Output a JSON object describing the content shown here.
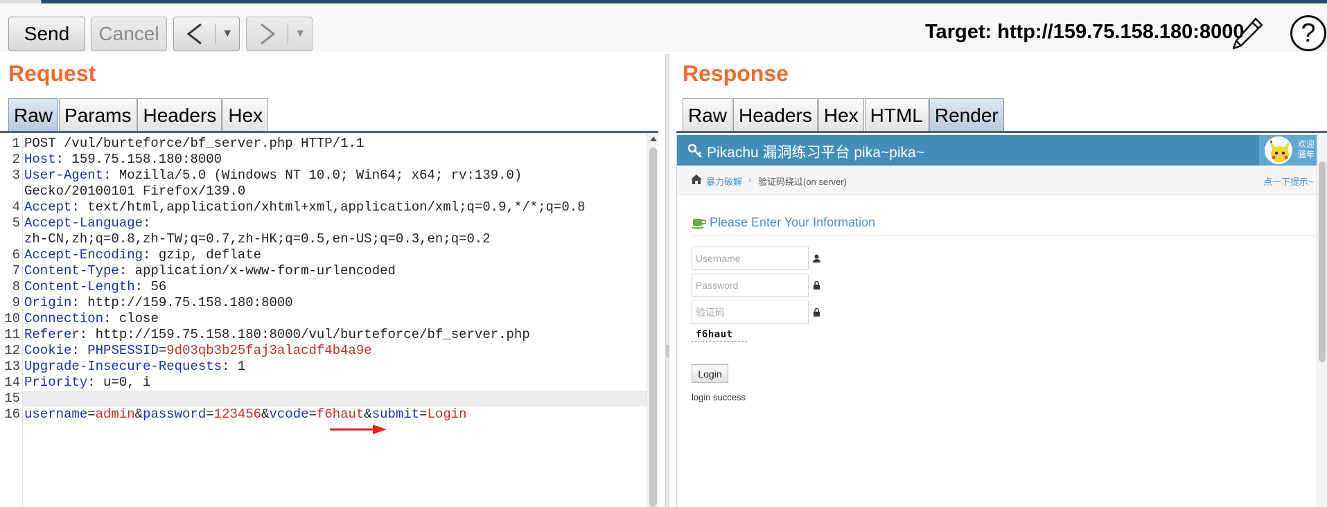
{
  "toolbar": {
    "send_label": "Send",
    "cancel_label": "Cancel",
    "back_glyph": "<",
    "forward_glyph": ">",
    "dropdown_glyph": "▼",
    "target_text": "Target: http://159.75.158.180:8000",
    "edit_icon": "pencil-icon",
    "help_glyph": "?"
  },
  "request": {
    "title": "Request",
    "tabs": [
      {
        "label": "Raw",
        "active": true
      },
      {
        "label": "Params",
        "active": false
      },
      {
        "label": "Headers",
        "active": false
      },
      {
        "label": "Hex",
        "active": false
      }
    ],
    "lines": [
      {
        "n": "1",
        "parts": [
          {
            "t": "POST /vul/burteforce/bf_server.php HTTP/1.1",
            "c": "plain"
          }
        ]
      },
      {
        "n": "2",
        "parts": [
          {
            "t": "Host",
            "c": "key"
          },
          {
            "t": ": 159.75.158.180:8000",
            "c": "plain"
          }
        ]
      },
      {
        "n": "3",
        "parts": [
          {
            "t": "User-Agent",
            "c": "key"
          },
          {
            "t": ": Mozilla/5.0 (Windows NT 10.0; Win64; x64; rv:139.0)",
            "c": "plain"
          }
        ]
      },
      {
        "n": "",
        "parts": [
          {
            "t": "Gecko/20100101 Firefox/139.0",
            "c": "plain"
          }
        ]
      },
      {
        "n": "4",
        "parts": [
          {
            "t": "Accept",
            "c": "key"
          },
          {
            "t": ": text/html,application/xhtml+xml,application/xml;q=0.9,*/*;q=0.8",
            "c": "plain"
          }
        ]
      },
      {
        "n": "5",
        "parts": [
          {
            "t": "Accept-Language",
            "c": "key"
          },
          {
            "t": ":",
            "c": "plain"
          }
        ]
      },
      {
        "n": "",
        "parts": [
          {
            "t": "zh-CN,zh;q=0.8,zh-TW;q=0.7,zh-HK;q=0.5,en-US;q=0.3,en;q=0.2",
            "c": "plain"
          }
        ]
      },
      {
        "n": "6",
        "parts": [
          {
            "t": "Accept-Encoding",
            "c": "key"
          },
          {
            "t": ": gzip, deflate",
            "c": "plain"
          }
        ]
      },
      {
        "n": "7",
        "parts": [
          {
            "t": "Content-Type",
            "c": "key"
          },
          {
            "t": ": application/x-www-form-urlencoded",
            "c": "plain"
          }
        ]
      },
      {
        "n": "8",
        "parts": [
          {
            "t": "Content-Length",
            "c": "key"
          },
          {
            "t": ": 56",
            "c": "plain"
          }
        ]
      },
      {
        "n": "9",
        "parts": [
          {
            "t": "Origin",
            "c": "key"
          },
          {
            "t": ": http://159.75.158.180:8000",
            "c": "plain"
          }
        ]
      },
      {
        "n": "10",
        "parts": [
          {
            "t": "Connection",
            "c": "key"
          },
          {
            "t": ": close",
            "c": "plain"
          }
        ]
      },
      {
        "n": "11",
        "parts": [
          {
            "t": "Referer",
            "c": "key"
          },
          {
            "t": ": http://159.75.158.180:8000/vul/burteforce/bf_server.php",
            "c": "plain"
          }
        ]
      },
      {
        "n": "12",
        "parts": [
          {
            "t": "Cookie",
            "c": "key"
          },
          {
            "t": ": ",
            "c": "plain"
          },
          {
            "t": "PHPSESSID",
            "c": "key"
          },
          {
            "t": "=",
            "c": "plain"
          },
          {
            "t": "9d03qb3b25faj3alacdf4b4a9e",
            "c": "val"
          }
        ]
      },
      {
        "n": "13",
        "parts": [
          {
            "t": "Upgrade-Insecure-Requests",
            "c": "key"
          },
          {
            "t": ": 1",
            "c": "plain"
          }
        ]
      },
      {
        "n": "14",
        "parts": [
          {
            "t": "Priority",
            "c": "key"
          },
          {
            "t": ": u=0, i",
            "c": "plain"
          }
        ]
      },
      {
        "n": "15",
        "parts": [],
        "highlight": true
      },
      {
        "n": "16",
        "parts": [
          {
            "t": "username",
            "c": "key"
          },
          {
            "t": "=",
            "c": "plain"
          },
          {
            "t": "admin",
            "c": "val"
          },
          {
            "t": "&",
            "c": "plain"
          },
          {
            "t": "password",
            "c": "key"
          },
          {
            "t": "=",
            "c": "plain"
          },
          {
            "t": "123456",
            "c": "val"
          },
          {
            "t": "&",
            "c": "plain"
          },
          {
            "t": "vcode",
            "c": "key"
          },
          {
            "t": "=",
            "c": "plain"
          },
          {
            "t": "f6haut",
            "c": "val"
          },
          {
            "t": "&",
            "c": "plain"
          },
          {
            "t": "submit",
            "c": "key"
          },
          {
            "t": "=",
            "c": "plain"
          },
          {
            "t": "Login",
            "c": "val"
          }
        ]
      }
    ]
  },
  "response": {
    "title": "Response",
    "tabs": [
      {
        "label": "Raw",
        "active": false
      },
      {
        "label": "Headers",
        "active": false
      },
      {
        "label": "Hex",
        "active": false
      },
      {
        "label": "HTML",
        "active": false
      },
      {
        "label": "Render",
        "active": true
      }
    ],
    "render": {
      "site_title": "Pikachu 漏洞练习平台 pika~pika~",
      "welcome_line1": "欢迎",
      "welcome_line2": "骚年",
      "breadcrumb_1": "暴力破解",
      "breadcrumb_sep": "›",
      "breadcrumb_2": "验证码绕过(on server)",
      "hint_link": "点一下提示~",
      "section_title": "Please Enter Your Information",
      "username_placeholder": "Username",
      "password_placeholder": "Password",
      "vcode_placeholder": "验证码",
      "captcha_text": "f6haut",
      "login_button": "Login",
      "login_message": "login success"
    }
  },
  "colors": {
    "accent_orange": "#f26a2b",
    "key_blue": "#1d31a7",
    "value_red": "#c03028",
    "pikachu_header": "#438eb9"
  }
}
